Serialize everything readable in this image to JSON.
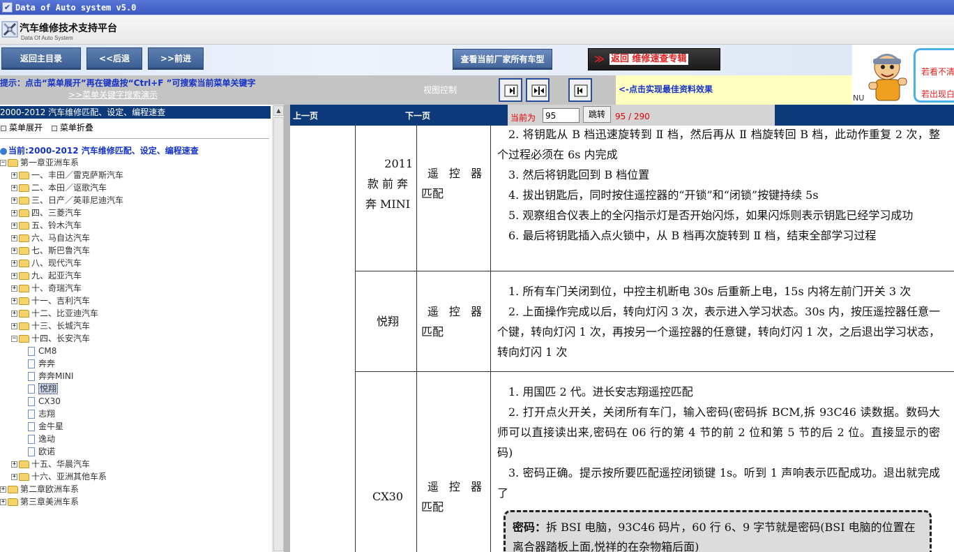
{
  "window": {
    "title": "Data of Auto system v5.0"
  },
  "brand": {
    "title": "汽车维修技术支持平台",
    "subtitle": "Data Of Auto System"
  },
  "toolbar": {
    "home": "返回主目录",
    "back": "<<后退",
    "forward": ">>前进",
    "models": "查看当前厂家所有车型",
    "quick_chevron": "≫",
    "quick": "返回 维修速查专辑"
  },
  "promo": {
    "line1": "若看不清",
    "line2": "若出现白",
    "nu": "NU"
  },
  "hint": {
    "text": "提示：点击“菜单展开”再在键盘按“Ctrl+F ”可搜索当前菜单关键字",
    "link": ">>菜单关键字搜索演示",
    "view_label": "视图控制",
    "view_hint": "<-点击实现最佳资料效果"
  },
  "sidebar": {
    "header": "2000-2012 汽车维修匹配、设定、编程速查",
    "expand": "菜单展开",
    "collapse": "菜单折叠",
    "current": "当前:2000-2012 汽车维修匹配、设定、编程速查",
    "tree": [
      {
        "label": "第一章亚洲车系",
        "level": 0,
        "type": "folder",
        "state": "open"
      },
      {
        "label": "一、丰田／雷克萨斯汽车",
        "level": 1,
        "type": "folder",
        "state": "closed"
      },
      {
        "label": "二、本田／讴歌汽车",
        "level": 1,
        "type": "folder",
        "state": "closed"
      },
      {
        "label": "三、日产／英菲尼迪汽车",
        "level": 1,
        "type": "folder",
        "state": "closed"
      },
      {
        "label": "四、三菱汽车",
        "level": 1,
        "type": "folder",
        "state": "closed"
      },
      {
        "label": "五、铃木汽车",
        "level": 1,
        "type": "folder",
        "state": "closed"
      },
      {
        "label": "六、马自达汽车",
        "level": 1,
        "type": "folder",
        "state": "closed"
      },
      {
        "label": "七、斯巴鲁汽车",
        "level": 1,
        "type": "folder",
        "state": "closed"
      },
      {
        "label": "八、现代汽车",
        "level": 1,
        "type": "folder",
        "state": "closed"
      },
      {
        "label": "九、起亚汽车",
        "level": 1,
        "type": "folder",
        "state": "closed"
      },
      {
        "label": "十、奇瑞汽车",
        "level": 1,
        "type": "folder",
        "state": "closed"
      },
      {
        "label": "十一、吉利汽车",
        "level": 1,
        "type": "folder",
        "state": "closed"
      },
      {
        "label": "十二、比亚迪汽车",
        "level": 1,
        "type": "folder",
        "state": "closed"
      },
      {
        "label": "十三、长城汽车",
        "level": 1,
        "type": "folder",
        "state": "closed"
      },
      {
        "label": "十四、长安汽车",
        "level": 1,
        "type": "folder",
        "state": "open"
      },
      {
        "label": "CM8",
        "level": 2,
        "type": "doc"
      },
      {
        "label": "奔奔",
        "level": 2,
        "type": "doc"
      },
      {
        "label": "奔奔MINI",
        "level": 2,
        "type": "doc"
      },
      {
        "label": "悦翔",
        "level": 2,
        "type": "doc",
        "selected": true
      },
      {
        "label": "CX30",
        "level": 2,
        "type": "doc"
      },
      {
        "label": "志翔",
        "level": 2,
        "type": "doc"
      },
      {
        "label": "金牛星",
        "level": 2,
        "type": "doc"
      },
      {
        "label": "逸动",
        "level": 2,
        "type": "doc"
      },
      {
        "label": "欧诺",
        "level": 2,
        "type": "doc"
      },
      {
        "label": "十五、华晨汽车",
        "level": 1,
        "type": "folder",
        "state": "closed"
      },
      {
        "label": "十六、亚洲其他车系",
        "level": 1,
        "type": "folder",
        "state": "closed"
      },
      {
        "label": "第二章欧洲车系",
        "level": 0,
        "type": "folder",
        "state": "closed"
      },
      {
        "label": "第三章美洲车系",
        "level": 0,
        "type": "folder",
        "state": "closed"
      }
    ]
  },
  "pager": {
    "prev": "上一页",
    "next": "下一页",
    "current_label": "当前为",
    "current_value": "95",
    "goto": "跳转",
    "count": "95 / 290"
  },
  "document": {
    "rows": [
      {
        "model": [
          "2011",
          "款 前 奔",
          "奔 MINI"
        ],
        "func": [
          "遥 控 器",
          "匹配"
        ],
        "desc": [
          "2. 将钥匙从 B 档迅速旋转到 Ⅱ 档，然后再从 Ⅱ 档旋转回 B 档，此动作重复 2 次，整个过程必须在 6s 内完成",
          "3. 然后将钥匙回到 B 档位置",
          "4. 拔出钥匙后，同时按住遥控器的“开锁”和“闭锁”按键持续 5s",
          "5. 观察组合仪表上的全闪指示灯是否开始闪烁，如果闪烁则表示钥匙已经学习成功",
          "6. 最后将钥匙插入点火锁中，从 B 档再次旋转到 Ⅱ 档，结束全部学习过程"
        ]
      },
      {
        "model": [
          "悦翔"
        ],
        "func": [
          "遥 控 器",
          "匹配"
        ],
        "desc": [
          "1. 所有车门关闭到位，中控主机断电 30s 后重新上电，15s 内将左前门开关 3 次",
          "2. 上面操作完成以后，转向灯闪 3 次，表示进入学习状态。30s 内，按压遥控器任意一个键，转向灯闪 1 次，再按另一个遥控器的任意键，转向灯闪 1 次，之后退出学习状态，转向灯闪 1 次"
        ]
      },
      {
        "model": [
          "CX30"
        ],
        "func": [
          "遥 控 器",
          "匹配"
        ],
        "desc": [
          "1. 用国匹 2 代。进长安志翔遥控匹配",
          "2. 打开点火开关，关闭所有车门，输入密码(密码拆 BCM,拆 93C46 读数据。数码大师可以直接读出来,密码在 06 行的第 4 节的前 2 位和第 5 节的后 2 位。直接显示的密码)",
          "3. 密码正确。提示按所要匹配遥控闭锁键 1s。听到 1 声响表示匹配成功。退出就完成了"
        ]
      }
    ],
    "note_label": "密码：",
    "note_text": "拆 BSI 电脑，93C46 码片，60 行 6、9 字节就是密码(BSI 电脑的位置在离合器踏板上面,悦祥的在杂物箱后面)"
  }
}
